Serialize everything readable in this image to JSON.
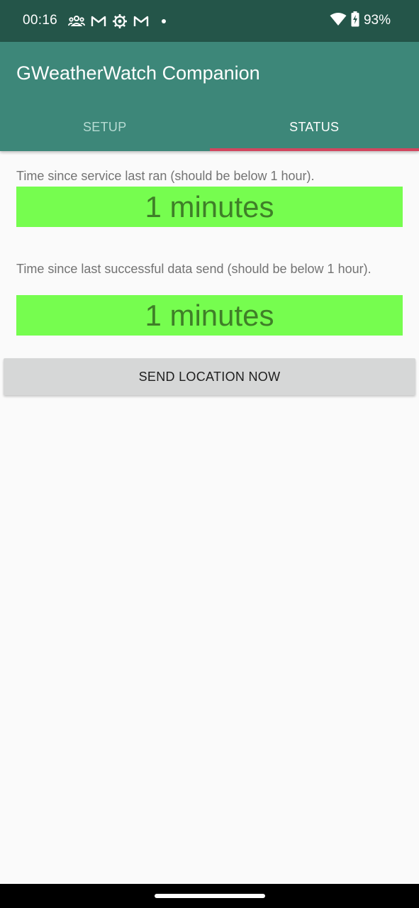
{
  "status_bar": {
    "time": "00:16",
    "battery": "93%",
    "icons_left": [
      "group-icon",
      "gmail-icon",
      "settings-gear-icon",
      "gmail-icon",
      "notification-dot"
    ],
    "icons_right": [
      "wifi-icon",
      "battery-charging-icon"
    ]
  },
  "app_bar": {
    "title": "GWeatherWatch Companion",
    "background": "#3d8779"
  },
  "tabs": [
    {
      "label": "SETUP",
      "active": false
    },
    {
      "label": "STATUS",
      "active": true
    }
  ],
  "status": {
    "service_label": "Time since service last ran (should be below 1 hour).",
    "service_value": "1 minutes",
    "send_label": "Time since last successful data send (should be below 1 hour).",
    "send_value": "1 minutes",
    "ok_color": "#76fd4f"
  },
  "actions": {
    "send_button": "SEND LOCATION NOW"
  }
}
